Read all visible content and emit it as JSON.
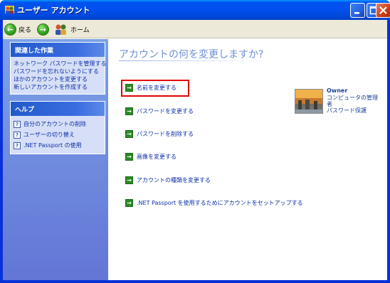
{
  "window": {
    "title": "ユーザー アカウント"
  },
  "toolbar": {
    "back_label": "戻る",
    "home_label": "ホーム"
  },
  "sidebar": {
    "related_tasks": {
      "title": "関連した作業",
      "items": [
        "ネットワーク パスワードを管理する",
        "パスワードを忘れないようにする",
        "ほかのアカウントを変更する",
        "新しいアカウントを作成する"
      ]
    },
    "help": {
      "title": "ヘルプ",
      "items": [
        "自分のアカウントの削除",
        "ユーザーの切り替え",
        ".NET Passport の使用"
      ]
    }
  },
  "main": {
    "heading": "アカウントの何を変更しますか?",
    "actions": [
      "名前を変更する",
      "パスワードを変更する",
      "パスワードを削除する",
      "画像を変更する",
      "アカウントの種類を変更する",
      ".NET Passport を使用するためにアカウントをセットアップする"
    ]
  },
  "user": {
    "name": "Owner",
    "line1": "コンピュータの管理",
    "line2": "者",
    "line3": "パスワード保護"
  },
  "colors": {
    "highlight": "#e00000",
    "link": "#0c2ea7",
    "heading": "#6e8fd3"
  }
}
